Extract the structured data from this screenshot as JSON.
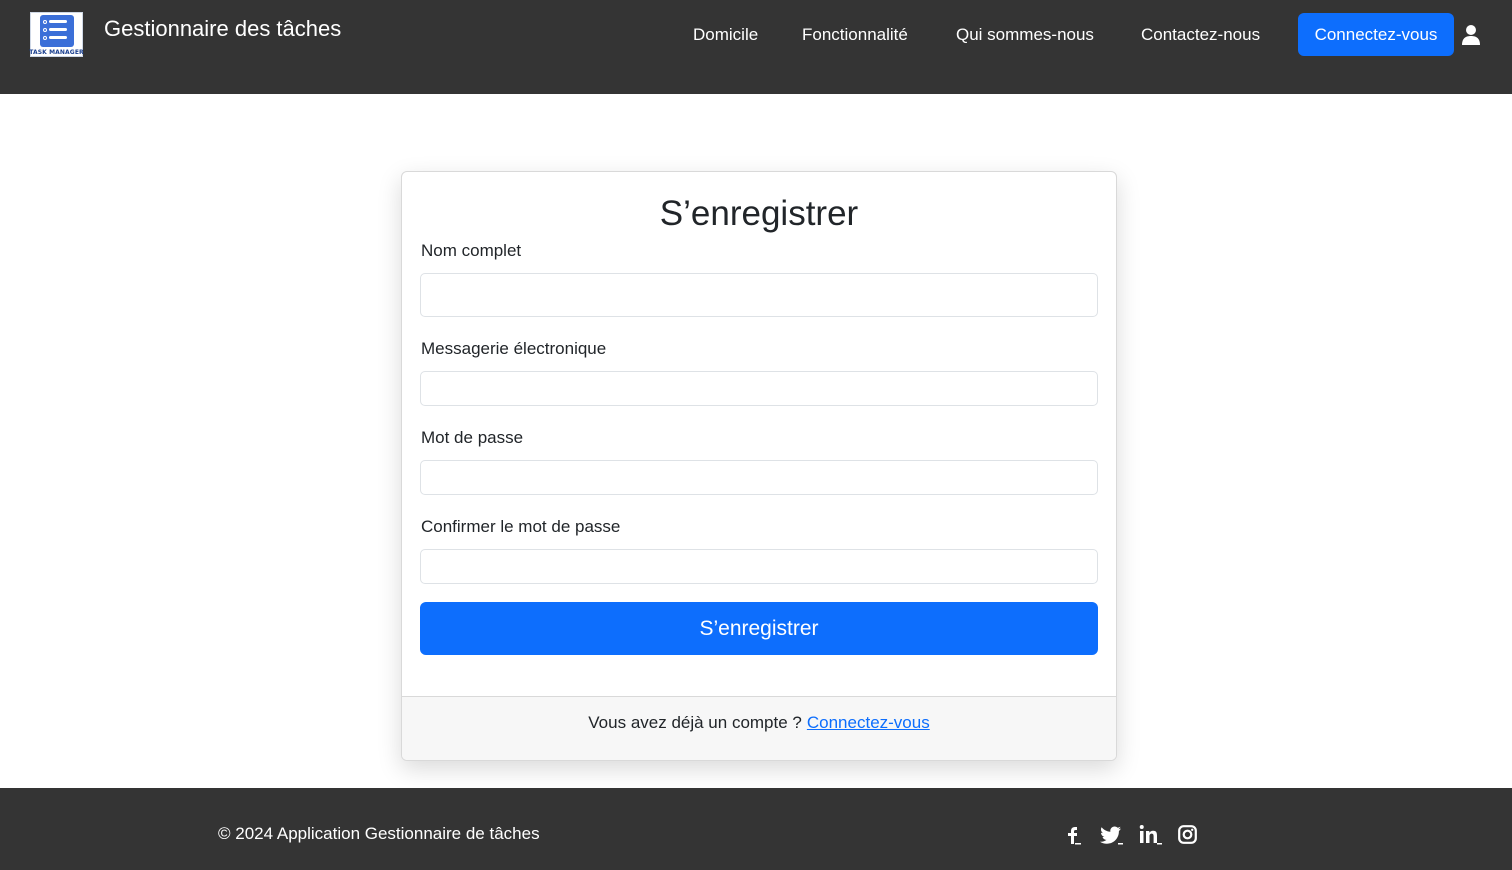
{
  "navbar": {
    "logo_text": "TASK MANAGER",
    "brand": "Gestionnaire des tâches",
    "links": [
      "Domicile",
      "Fonctionnalité",
      "Qui sommes-nous",
      "Contactez-nous"
    ],
    "login_button": "Connectez-vous",
    "user_icon": "user-icon"
  },
  "form": {
    "title": "S’enregistrer",
    "fields": [
      {
        "label": "Nom complet",
        "value": ""
      },
      {
        "label": "Messagerie électronique",
        "value": ""
      },
      {
        "label": "Mot de passe",
        "value": ""
      },
      {
        "label": "Confirmer le mot de passe",
        "value": ""
      }
    ],
    "submit_label": "S’enregistrer",
    "footer_text": "Vous avez déjà un compte ?",
    "footer_link": "Connectez-vous"
  },
  "footer": {
    "copyright": "© 2024 Application Gestionnaire de tâches",
    "social": [
      "facebook-icon",
      "twitter-icon",
      "linkedin-icon",
      "instagram-icon"
    ]
  },
  "colors": {
    "nav_bg": "#343434",
    "accent": "#0d6efd",
    "card_footer_bg": "#f7f7f7"
  }
}
